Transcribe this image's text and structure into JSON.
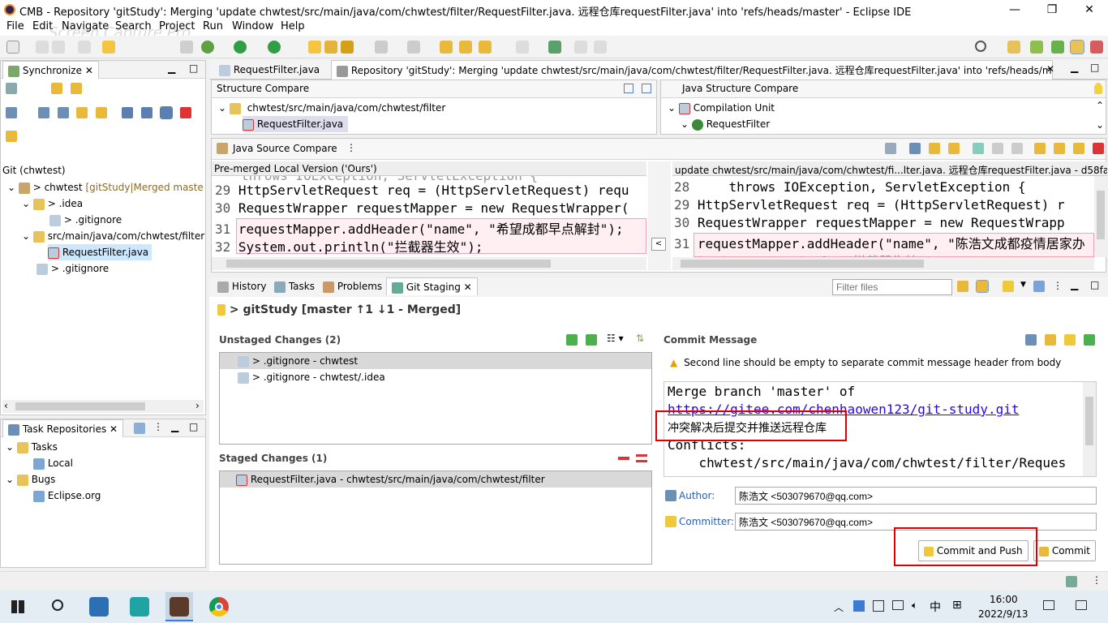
{
  "window": {
    "title": "CMB - Repository 'gitStudy': Merging 'update chwtest/src/main/java/com/chwtest/filter/RequestFilter.java. 远程仓库requestFilter.java' into 'refs/heads/master' - Eclipse IDE",
    "controls": [
      "—",
      "❐",
      "✕"
    ]
  },
  "menu": [
    "File",
    "Edit",
    "Navigate",
    "Search",
    "Project",
    "Run",
    "Window",
    "Help"
  ],
  "watermark": "Screen Capture Pro",
  "left": {
    "sync_tab": "Synchronize",
    "repo_label": "Git (chwtest)",
    "tree": [
      {
        "label": "> chwtest",
        "suffix": "[gitStudy|Merged maste"
      },
      {
        "label": "> .idea"
      },
      {
        "label": "> .gitignore"
      },
      {
        "label": "src/main/java/com/chwtest/filter"
      },
      {
        "label": "RequestFilter.java"
      },
      {
        "label": "> .gitignore"
      }
    ],
    "task_tab": "Task Repositories",
    "tasks": [
      "Tasks",
      "Local",
      "Bugs",
      "Eclipse.org"
    ]
  },
  "editor": {
    "tabs": [
      "RequestFilter.java",
      "Repository 'gitStudy': Merging 'update chwtest/src/main/java/com/chwtest/filter/RequestFilter.java. 远程仓库requestFilter.java' into 'refs/heads/m..."
    ],
    "structure_compare": "Structure Compare",
    "structure_path": "chwtest/src/main/java/com/chwtest/filter",
    "structure_file": "RequestFilter.java",
    "java_structure_compare": "Java Structure Compare",
    "compilation_unit": "Compilation Unit",
    "java_class": "RequestFilter",
    "java_source_compare": "Java Source Compare",
    "left_title": "Pre-merged Local Version ('Ours')",
    "right_title": "update chwtest/src/main/java/com/chwtest/fi...lter.java. 远程仓库requestFilter.java - d58fab5",
    "left_partial_top": "throws IOException, ServletException {",
    "left_lines": [
      {
        "n": "29",
        "t": "HttpServletRequest req = (HttpServletRequest) requ"
      },
      {
        "n": "30",
        "t": "RequestWrapper requestMapper = new RequestWrapper("
      },
      {
        "n": "31",
        "t": "requestMapper.addHeader(\"name\", \"希望成都早点解封\");"
      },
      {
        "n": "32",
        "t": "System.out.println(\"拦截器生效\");"
      }
    ],
    "right_lines": [
      {
        "n": "28",
        "t": "    throws IOException, ServletException {"
      },
      {
        "n": "29",
        "t": "HttpServletRequest req = (HttpServletRequest) r"
      },
      {
        "n": "30",
        "t": "RequestWrapper requestMapper = new RequestWrapp"
      },
      {
        "n": "31",
        "t": "requestMapper.addHeader(\"name\", \"陈浩文成都疫情居家办"
      }
    ],
    "right_partial_bottom": "System.out.println(\"拦截器生效\");"
  },
  "staging": {
    "tabs": [
      "History",
      "Tasks",
      "Problems",
      "Git Staging"
    ],
    "filter_placeholder": "Filter files",
    "repo_header": "> gitStudy [master ↑1 ↓1 - Merged]",
    "unstaged_title": "Unstaged Changes (2)",
    "unstaged": [
      "> .gitignore - chwtest",
      "> .gitignore - chwtest/.idea"
    ],
    "staged_title": "Staged Changes (1)",
    "staged": [
      "RequestFilter.java - chwtest/src/main/java/com/chwtest/filter"
    ],
    "commit_title": "Commit Message",
    "warning": "Second line should be empty to separate commit message header from body",
    "message_lines": [
      "Merge branch 'master' of",
      "https://gitee.com/chenhaowen123/git-study.git",
      "冲突解决后提交并推送远程仓库",
      "Conflicts:",
      "    chwtest/src/main/java/com/chwtest/filter/Reques"
    ],
    "author_label": "Author:",
    "author": "陈浩文 <503079670@qq.com>",
    "committer_label": "Committer:",
    "committer": "陈浩文 <503079670@qq.com>",
    "commit_push": "Commit and Push",
    "commit": "Commit"
  },
  "taskbar": {
    "time": "16:00",
    "date": "2022/9/13",
    "ime": "中",
    "lang": "⊞"
  },
  "colors": {
    "highlight_red": "#e00000",
    "diff_bg": "#ffeef2",
    "diff_border": "#f4a0b4",
    "code_keyword": "#7f0055",
    "code_string": "#2a00ff"
  }
}
